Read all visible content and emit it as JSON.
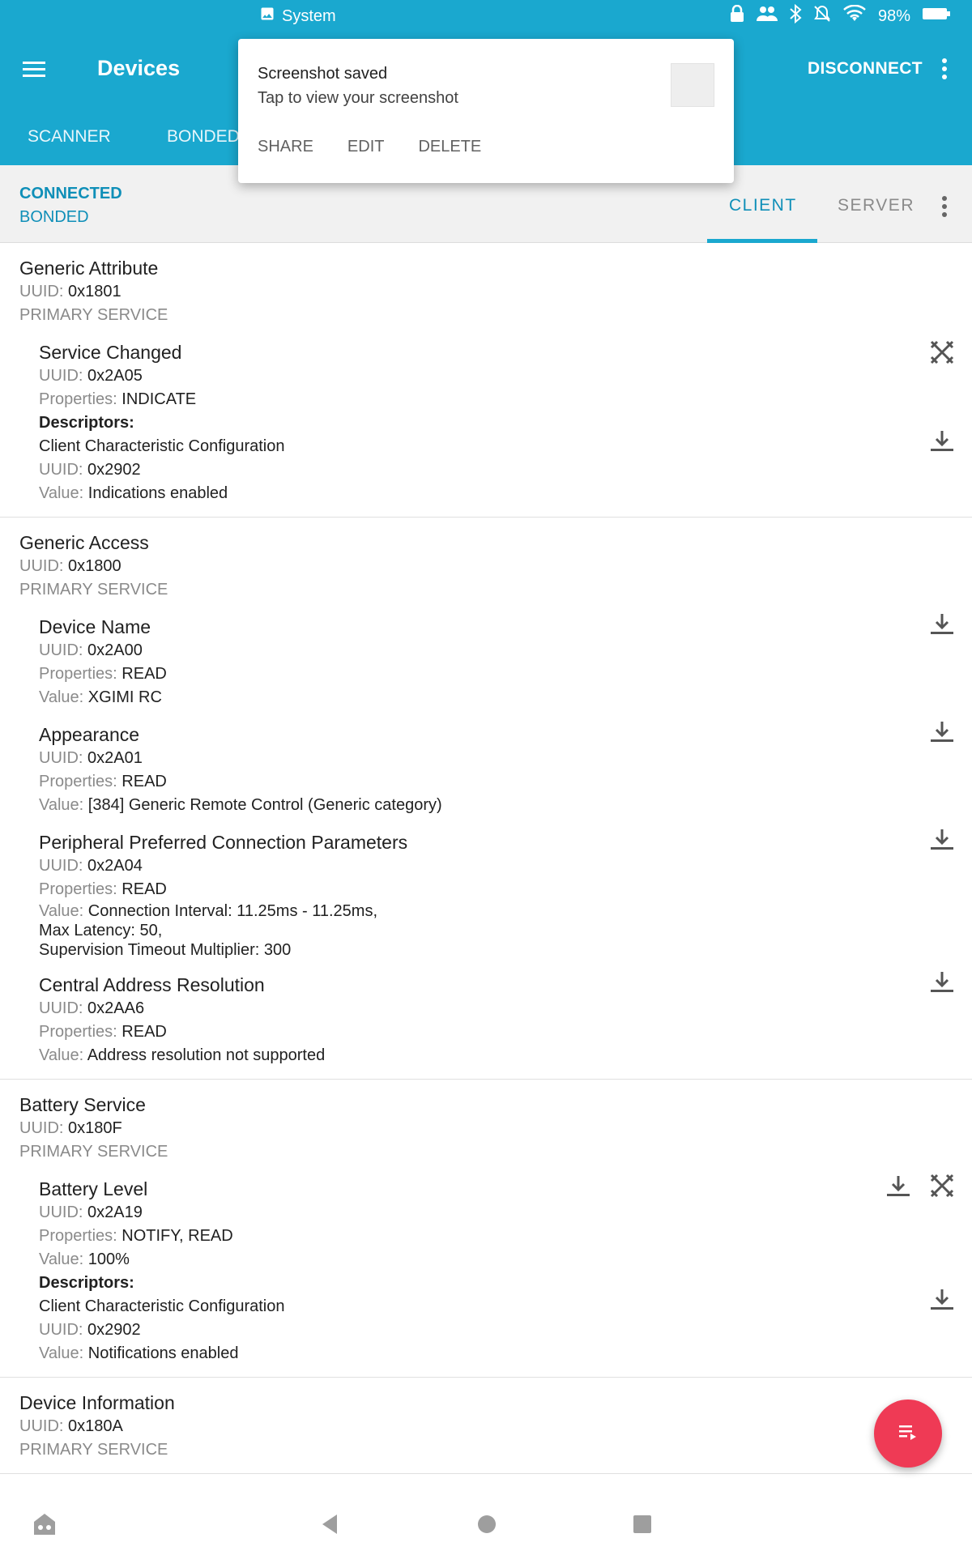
{
  "status_bar": {
    "app_label": "System",
    "battery": "98%",
    "icons": [
      "image-icon",
      "vpn-lock-icon",
      "people-icon",
      "bluetooth-icon",
      "bell-off-icon",
      "wifi-icon",
      "battery-icon"
    ]
  },
  "toolbar": {
    "title": "Devices",
    "disconnect_label": "DISCONNECT"
  },
  "main_tabs": [
    {
      "label": "SCANNER"
    },
    {
      "label": "BONDED"
    }
  ],
  "connection": {
    "state": "CONNECTED",
    "bond": "BONDED"
  },
  "sub_tabs": [
    {
      "label": "CLIENT",
      "active": true
    },
    {
      "label": "SERVER",
      "active": false
    }
  ],
  "labels": {
    "uuid": "UUID:",
    "properties": "Properties:",
    "value": "Value:",
    "descriptors": "Descriptors:"
  },
  "services": [
    {
      "name": "Generic Attribute",
      "uuid": "0x1801",
      "type": "PRIMARY SERVICE",
      "characteristics": [
        {
          "name": "Service Changed",
          "uuid": "0x2A05",
          "properties": "INDICATE",
          "descriptor": {
            "name": "Client Characteristic Configuration",
            "uuid": "0x2902",
            "value": "Indications enabled"
          }
        }
      ]
    },
    {
      "name": "Generic Access",
      "uuid": "0x1800",
      "type": "PRIMARY SERVICE",
      "characteristics": [
        {
          "name": "Device Name",
          "uuid": "0x2A00",
          "properties": "READ",
          "value": "XGIMI RC"
        },
        {
          "name": "Appearance",
          "uuid": "0x2A01",
          "properties": "READ",
          "value": "[384] Generic Remote Control (Generic category)"
        },
        {
          "name": "Peripheral Preferred Connection Parameters",
          "uuid": "0x2A04",
          "properties": "READ",
          "value_lines": [
            "Connection Interval: 11.25ms - 11.25ms,",
            "Max Latency: 50,",
            "Supervision Timeout Multiplier: 300"
          ]
        },
        {
          "name": "Central Address Resolution",
          "uuid": "0x2AA6",
          "properties": "READ",
          "value": "Address resolution not supported"
        }
      ]
    },
    {
      "name": "Battery Service",
      "uuid": "0x180F",
      "type": "PRIMARY SERVICE",
      "characteristics": [
        {
          "name": "Battery Level",
          "uuid": "0x2A19",
          "properties": "NOTIFY, READ",
          "value": "100%",
          "descriptor": {
            "name": "Client Characteristic Configuration",
            "uuid": "0x2902",
            "value": "Notifications enabled"
          }
        }
      ]
    },
    {
      "name": "Device Information",
      "uuid": "0x180A",
      "type": "PRIMARY SERVICE"
    }
  ],
  "notification": {
    "title": "Screenshot saved",
    "subtitle": "Tap to view your screenshot",
    "actions": [
      "SHARE",
      "EDIT",
      "DELETE"
    ]
  },
  "colors": {
    "primary": "#1aa8cf",
    "accent_text": "#0f8fb8",
    "fab": "#ef3a55"
  }
}
